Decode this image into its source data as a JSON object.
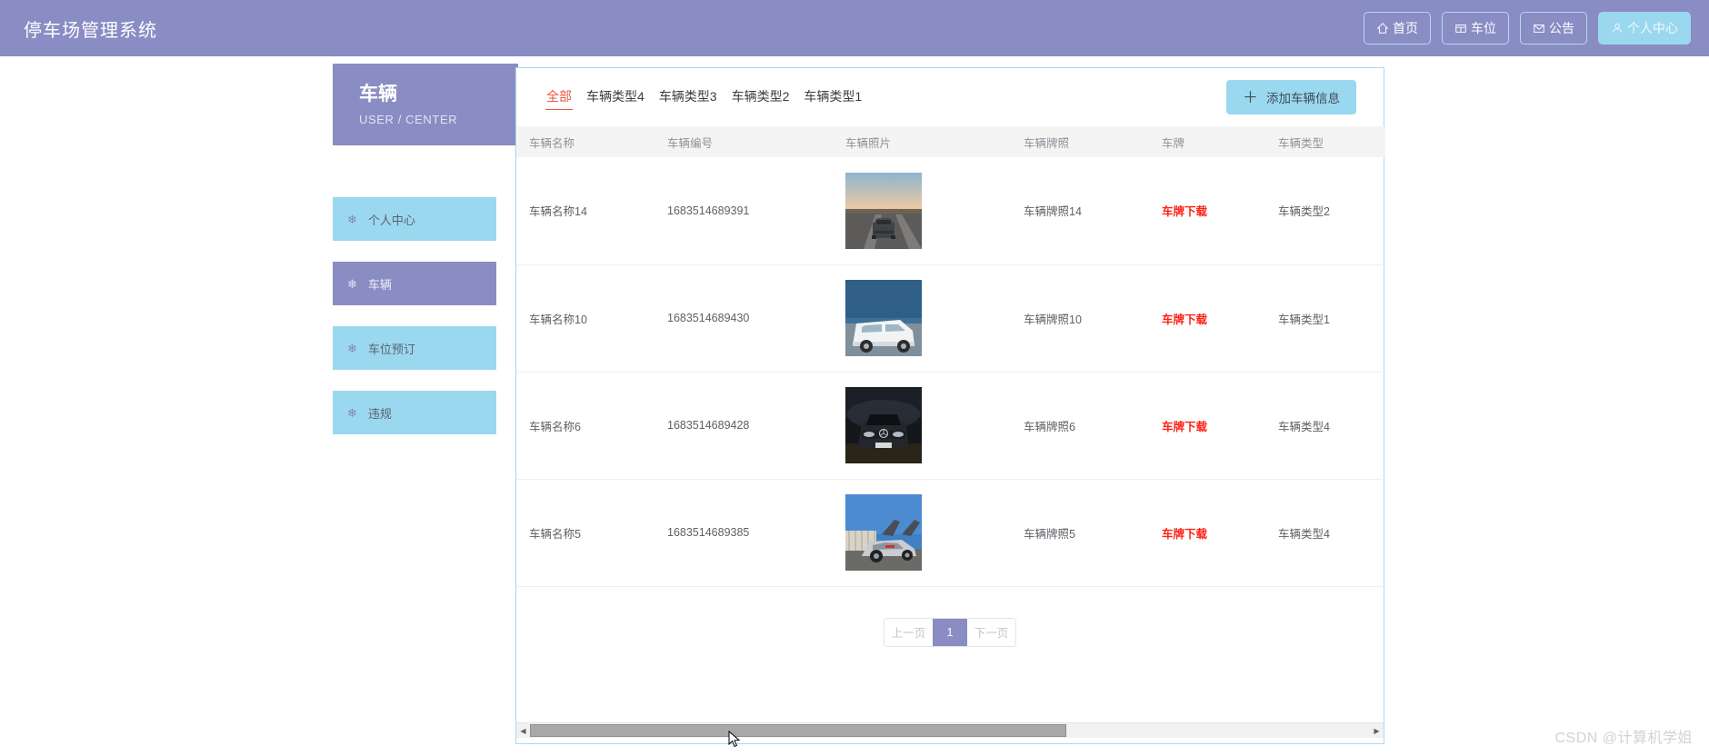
{
  "header": {
    "brand": "停车场管理系统",
    "nav": [
      {
        "label": "首页",
        "icon": "home-icon",
        "active": false
      },
      {
        "label": "车位",
        "icon": "grid-icon",
        "active": false
      },
      {
        "label": "公告",
        "icon": "mail-icon",
        "active": false
      },
      {
        "label": "个人中心",
        "icon": "user-icon",
        "active": true
      }
    ]
  },
  "sidebar": {
    "title": "车辆",
    "subtitle": "USER / CENTER",
    "items": [
      {
        "label": "个人中心",
        "icon": "snowflake-icon",
        "active": false
      },
      {
        "label": "车辆",
        "icon": "snowflake-icon",
        "active": true
      },
      {
        "label": "车位预订",
        "icon": "snowflake-icon",
        "active": false
      },
      {
        "label": "违规",
        "icon": "snowflake-icon",
        "active": false
      }
    ]
  },
  "main": {
    "tabs": [
      {
        "label": "全部",
        "active": true
      },
      {
        "label": "车辆类型4",
        "active": false
      },
      {
        "label": "车辆类型3",
        "active": false
      },
      {
        "label": "车辆类型2",
        "active": false
      },
      {
        "label": "车辆类型1",
        "active": false
      }
    ],
    "add_button": "添加车辆信息",
    "add_button_plus": "＋",
    "table": {
      "columns": [
        "车辆名称",
        "车辆编号",
        "车辆照片",
        "车辆牌照",
        "车牌",
        "车辆类型"
      ],
      "rows": [
        {
          "name": "车辆名称14",
          "code": "1683514689391",
          "photo": "gray-sedan-highway-sunset",
          "plate_photo": "车辆牌照14",
          "plate_link": "车牌下载",
          "type": "车辆类型2"
        },
        {
          "name": "车辆名称10",
          "code": "1683514689430",
          "photo": "white-van-seaside",
          "plate_photo": "车辆牌照10",
          "plate_link": "车牌下载",
          "type": "车辆类型1"
        },
        {
          "name": "车辆名称6",
          "code": "1683514689428",
          "photo": "black-suv-night",
          "plate_photo": "车辆牌照6",
          "plate_link": "车牌下载",
          "type": "车辆类型4"
        },
        {
          "name": "车辆名称5",
          "code": "1683514689385",
          "photo": "silver-gullwing-sky",
          "plate_photo": "车辆牌照5",
          "plate_link": "车牌下载",
          "type": "车辆类型4"
        }
      ]
    },
    "pagination": {
      "prev": "上一页",
      "current": "1",
      "next": "下一页"
    }
  },
  "watermark": "CSDN @计算机学姐",
  "colors": {
    "brand_purple": "#8a8cc4",
    "accent_blue": "#9ad8ef",
    "tab_active": "#e8573f",
    "download_link": "#ff1f12"
  }
}
